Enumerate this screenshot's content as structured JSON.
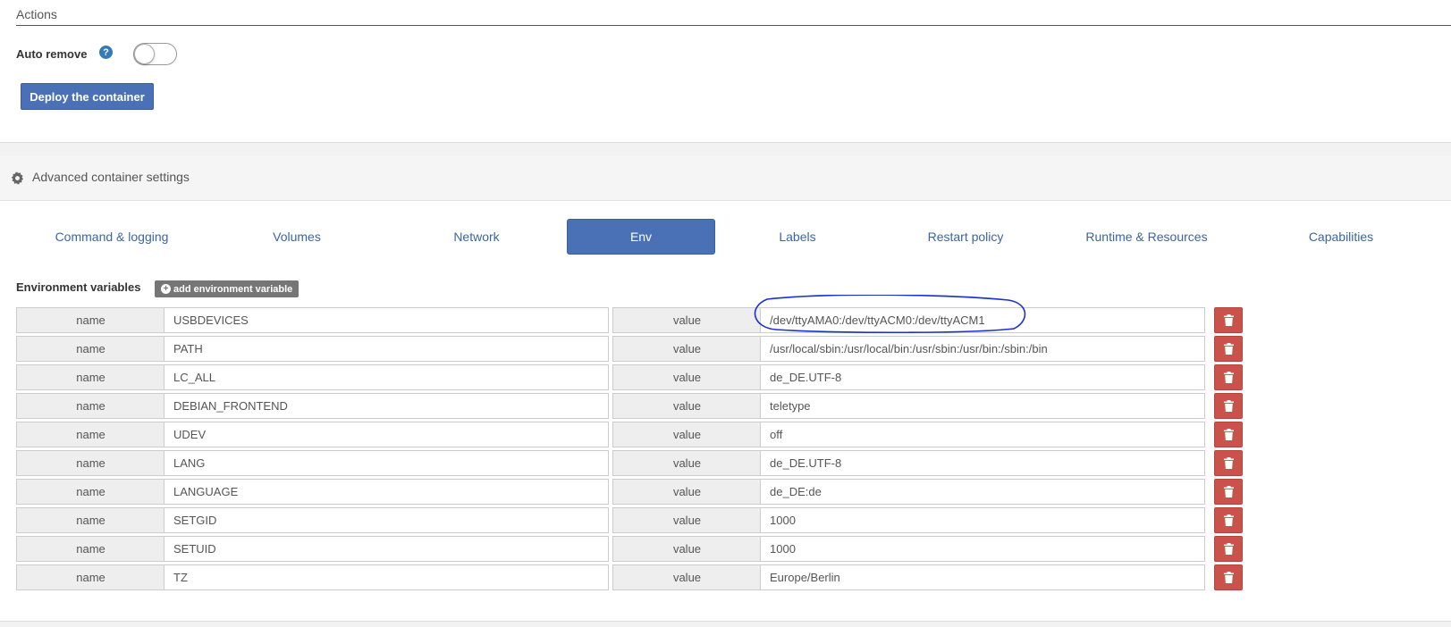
{
  "actions": {
    "title": "Actions",
    "auto_remove_label": "Auto remove",
    "help_glyph": "?",
    "auto_remove_enabled": false,
    "deploy_label": "Deploy the container"
  },
  "advanced": {
    "title": "Advanced container settings",
    "icon": "gear-icon"
  },
  "tabs": [
    {
      "label": "Command & logging",
      "active": false
    },
    {
      "label": "Volumes",
      "active": false
    },
    {
      "label": "Network",
      "active": false
    },
    {
      "label": "Env",
      "active": true
    },
    {
      "label": "Labels",
      "active": false
    },
    {
      "label": "Restart policy",
      "active": false
    },
    {
      "label": "Runtime & Resources",
      "active": false
    },
    {
      "label": "Capabilities",
      "active": false
    }
  ],
  "env": {
    "section_label": "Environment variables",
    "add_label": "add environment variable",
    "name_addon": "name",
    "value_addon": "value",
    "rows": [
      {
        "name": "USBDEVICES",
        "value": "/dev/ttyAMA0:/dev/ttyACM0:/dev/ttyACM1"
      },
      {
        "name": "PATH",
        "value": "/usr/local/sbin:/usr/local/bin:/usr/sbin:/usr/bin:/sbin:/bin"
      },
      {
        "name": "LC_ALL",
        "value": "de_DE.UTF-8"
      },
      {
        "name": "DEBIAN_FRONTEND",
        "value": "teletype"
      },
      {
        "name": "UDEV",
        "value": "off"
      },
      {
        "name": "LANG",
        "value": "de_DE.UTF-8"
      },
      {
        "name": "LANGUAGE",
        "value": "de_DE:de"
      },
      {
        "name": "SETGID",
        "value": "1000"
      },
      {
        "name": "SETUID",
        "value": "1000"
      },
      {
        "name": "TZ",
        "value": "Europe/Berlin"
      }
    ]
  },
  "colors": {
    "primary": "#4a71b5",
    "danger": "#c9524a",
    "annotation": "#1a2fd6"
  }
}
